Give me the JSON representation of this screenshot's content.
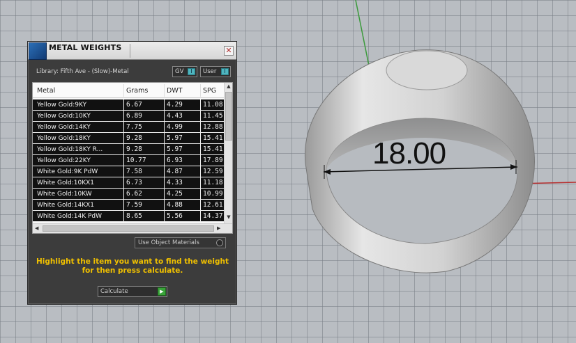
{
  "panel": {
    "title": "METAL WEIGHTS",
    "close_glyph": "✕",
    "library_label": "Library: Fifth Ave - (Slow)-Metal",
    "toggles": [
      {
        "label": "GV",
        "knob": "I"
      },
      {
        "label": "User",
        "knob": "I"
      }
    ],
    "table": {
      "headers": [
        "Metal",
        "Grams",
        "DWT",
        "SPG"
      ],
      "rows": [
        [
          "Yellow Gold:9KY",
          "6.67",
          "4.29",
          "11.08"
        ],
        [
          "Yellow Gold:10KY",
          "6.89",
          "4.43",
          "11.45"
        ],
        [
          "Yellow Gold:14KY",
          "7.75",
          "4.99",
          "12.88"
        ],
        [
          "Yellow Gold:18KY",
          "9.28",
          "5.97",
          "15.41"
        ],
        [
          "Yellow Gold:18KY R...",
          "9.28",
          "5.97",
          "15.41"
        ],
        [
          "Yellow Gold:22KY",
          "10.77",
          "6.93",
          "17.89"
        ],
        [
          "White Gold:9K PdW",
          "7.58",
          "4.87",
          "12.59"
        ],
        [
          "White Gold:10KX1",
          "6.73",
          "4.33",
          "11.18"
        ],
        [
          "White Gold:10KW",
          "6.62",
          "4.25",
          "10.99"
        ],
        [
          "White Gold:14KX1",
          "7.59",
          "4.88",
          "12.61"
        ],
        [
          "White Gold:14K PdW",
          "8.65",
          "5.56",
          "14.37"
        ]
      ]
    },
    "use_object_materials": "Use Object Materials",
    "hint_line1": "Highlight the item you want to find the weight",
    "hint_line2": "for then press calculate.",
    "calculate_label": "Calculate"
  },
  "viewport": {
    "dimension_value": "18.00"
  },
  "colors": {
    "hint": "#f0c000",
    "toggle_knob": "#4fb5bf",
    "calc_go": "#3aa33a",
    "axis_green": "#3a9a3a",
    "axis_red": "#b83030"
  }
}
